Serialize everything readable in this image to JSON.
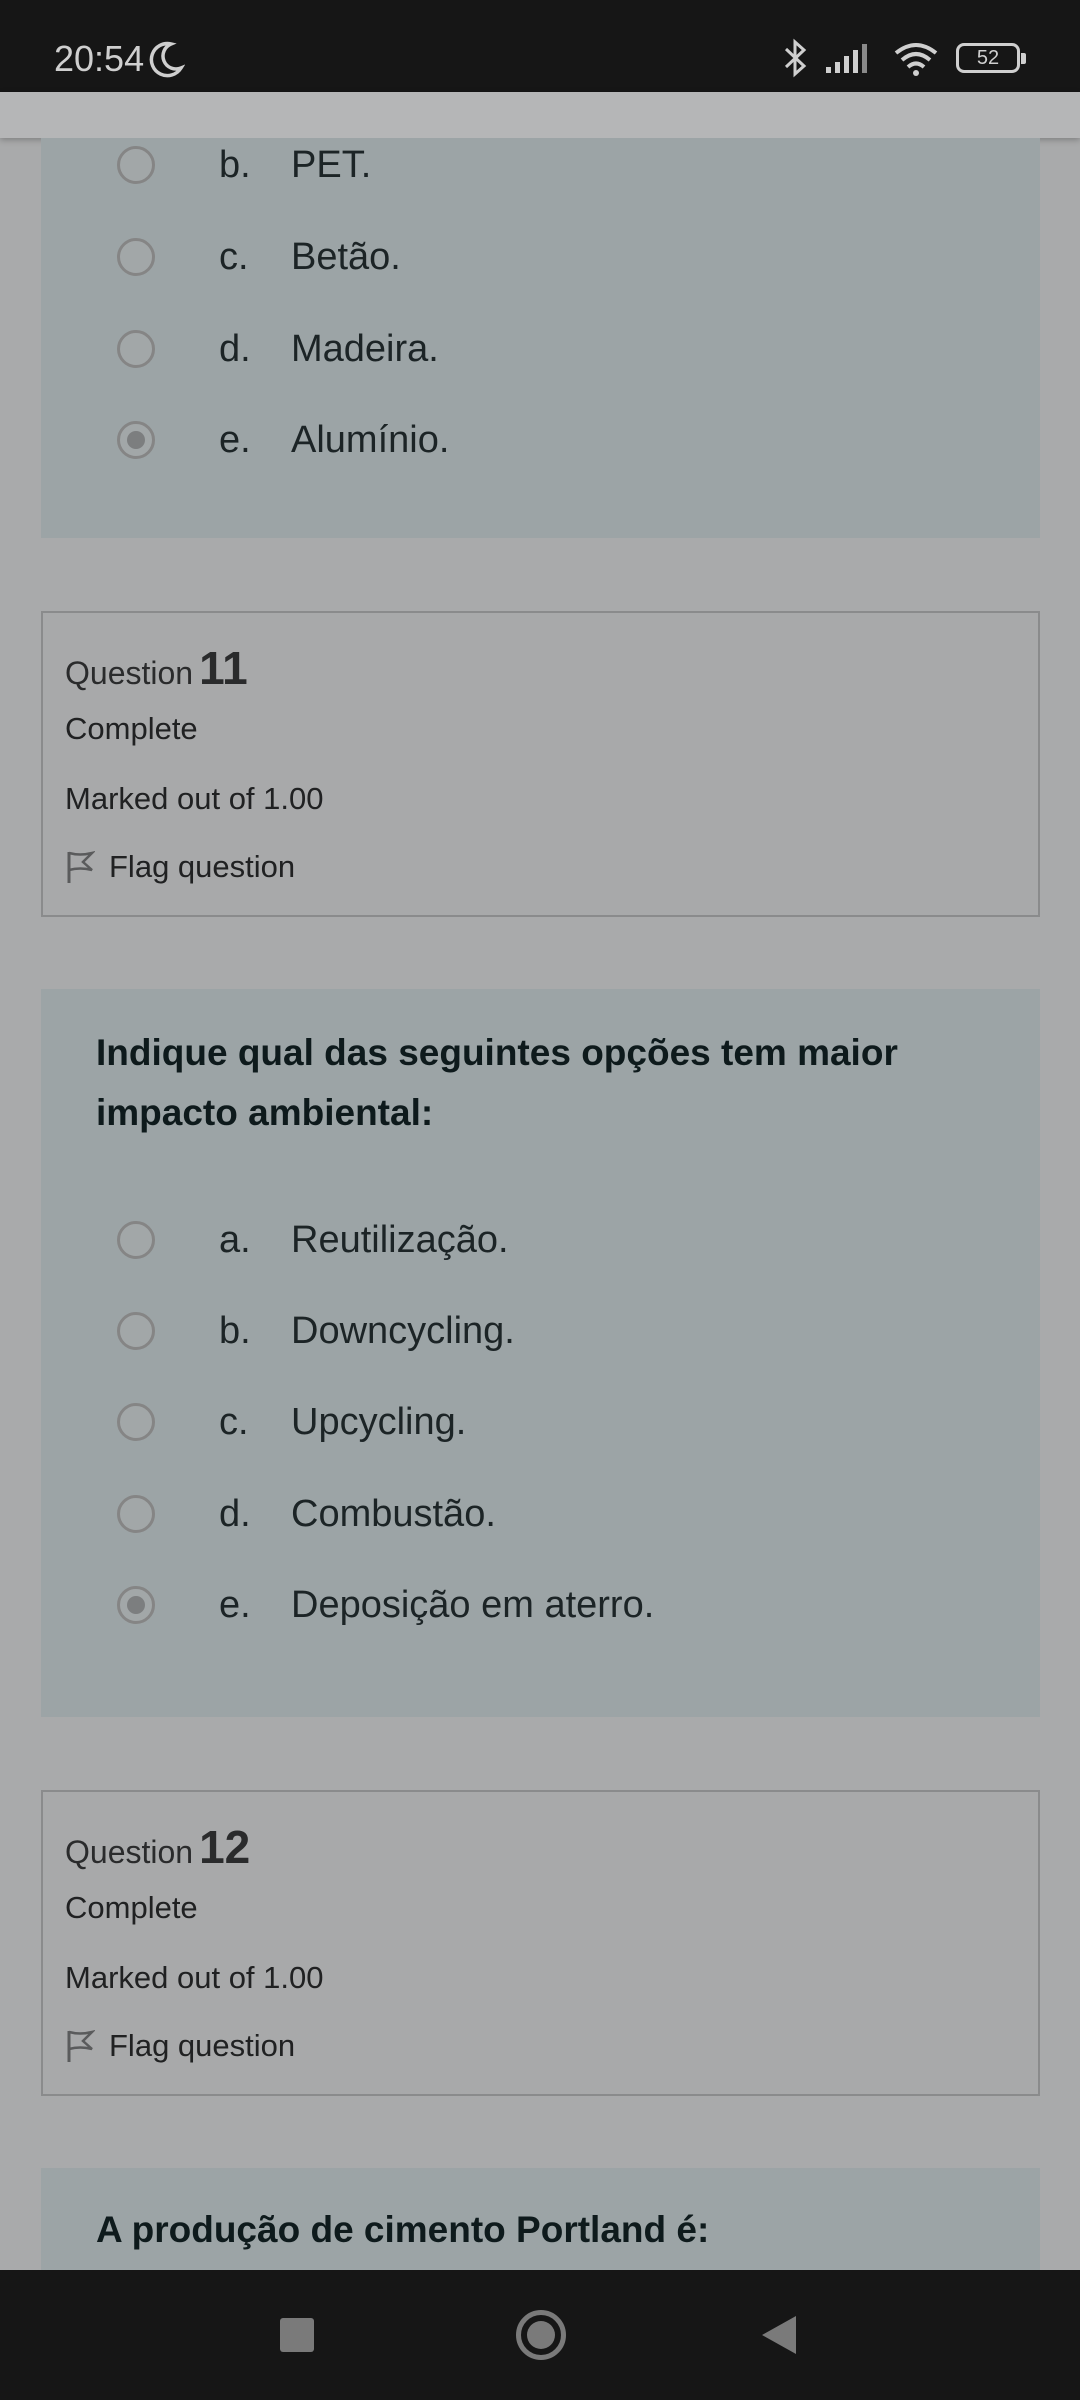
{
  "status_bar": {
    "time": "20:54",
    "battery": "52"
  },
  "question10_options": [
    {
      "letter": "b.",
      "text": "PET.",
      "checked": false
    },
    {
      "letter": "c.",
      "text": "Betão.",
      "checked": false
    },
    {
      "letter": "d.",
      "text": "Madeira.",
      "checked": false
    },
    {
      "letter": "e.",
      "text": "Alumínio.",
      "checked": true
    }
  ],
  "question11": {
    "label": "Question",
    "number": "11",
    "state": "Complete",
    "mark": "Marked out of 1.00",
    "flag": "Flag question",
    "prompt": "Indique qual das seguintes opções tem maior impacto ambiental:",
    "options": [
      {
        "letter": "a.",
        "text": "Reutilização.",
        "checked": false
      },
      {
        "letter": "b.",
        "text": "Downcycling.",
        "checked": false
      },
      {
        "letter": "c.",
        "text": "Upcycling.",
        "checked": false
      },
      {
        "letter": "d.",
        "text": "Combustão.",
        "checked": false
      },
      {
        "letter": "e.",
        "text": "Deposição em aterro.",
        "checked": true
      }
    ]
  },
  "question12": {
    "label": "Question",
    "number": "12",
    "state": "Complete",
    "mark": "Marked out of 1.00",
    "flag": "Flag question",
    "prompt": "A produção de cimento Portland é:"
  }
}
